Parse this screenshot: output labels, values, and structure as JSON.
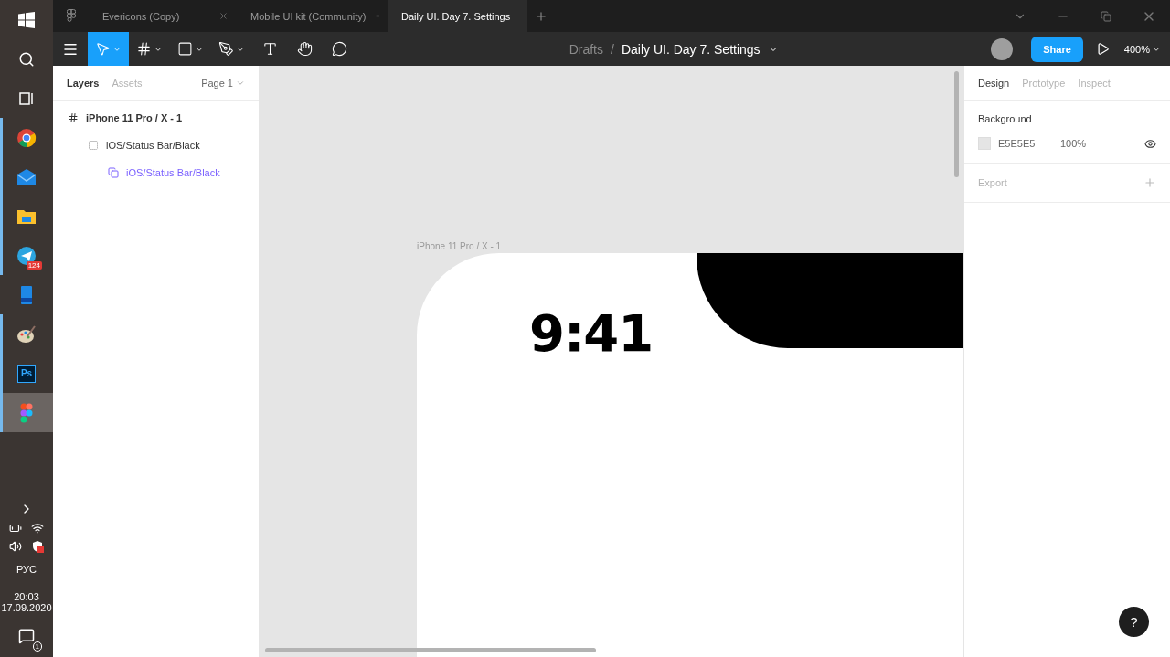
{
  "taskbar": {
    "apps": [
      {
        "kind": "chrome",
        "running": true,
        "selected": false
      },
      {
        "kind": "mail",
        "running": true,
        "selected": false
      },
      {
        "kind": "folder",
        "running": true,
        "selected": false
      },
      {
        "kind": "telegram",
        "running": true,
        "selected": false,
        "badge": "124"
      },
      {
        "kind": "phone",
        "running": false,
        "selected": false
      },
      {
        "kind": "palette",
        "running": true,
        "selected": false
      },
      {
        "kind": "photoshop",
        "running": true,
        "selected": false,
        "label": "Ps"
      },
      {
        "kind": "figma",
        "running": true,
        "selected": true
      }
    ],
    "tray": {
      "language": "РУС",
      "time": "20:03",
      "date": "17.09.2020",
      "notifications": "1"
    }
  },
  "tabs": [
    {
      "label": "Evericons (Copy)",
      "selected": false
    },
    {
      "label": "Mobile UI kit (Community)",
      "selected": false
    },
    {
      "label": "Daily UI. Day 7. Settings",
      "selected": true
    }
  ],
  "toolbar": {
    "tools": [
      {
        "kind": "move",
        "selected": true,
        "dropdown": true
      },
      {
        "kind": "frame",
        "selected": false,
        "dropdown": true
      },
      {
        "kind": "shape",
        "selected": false,
        "dropdown": true
      },
      {
        "kind": "pen",
        "selected": false,
        "dropdown": true
      },
      {
        "kind": "text",
        "selected": false,
        "dropdown": false
      },
      {
        "kind": "hand",
        "selected": false,
        "dropdown": false
      },
      {
        "kind": "comment",
        "selected": false,
        "dropdown": false
      }
    ],
    "breadcrumb": {
      "folder": "Drafts",
      "separator": "/",
      "file": "Daily UI. Day 7. Settings"
    },
    "share": "Share",
    "zoom": "400%"
  },
  "left_panel": {
    "tabs": [
      {
        "label": "Layers",
        "selected": true
      },
      {
        "label": "Assets",
        "selected": false
      }
    ],
    "page": "Page 1",
    "layers": [
      {
        "kind": "frame",
        "name": "iPhone 11 Pro / X - 1",
        "children": [
          {
            "kind": "group",
            "name": "iOS/Status Bar/Black",
            "children": [
              {
                "kind": "instance",
                "name": "iOS/Status Bar/Black"
              }
            ]
          }
        ]
      }
    ]
  },
  "canvas": {
    "frame_label": "iPhone 11 Pro / X - 1",
    "time": "9:41"
  },
  "right_panel": {
    "tabs": [
      {
        "label": "Design",
        "selected": true
      },
      {
        "label": "Prototype",
        "selected": false
      },
      {
        "label": "Inspect",
        "selected": false
      }
    ],
    "background": {
      "title": "Background",
      "color": "#e5e5e5",
      "hex": "E5E5E5",
      "opacity": "100%",
      "visible": true
    },
    "export": {
      "title": "Export"
    }
  },
  "help": "?"
}
